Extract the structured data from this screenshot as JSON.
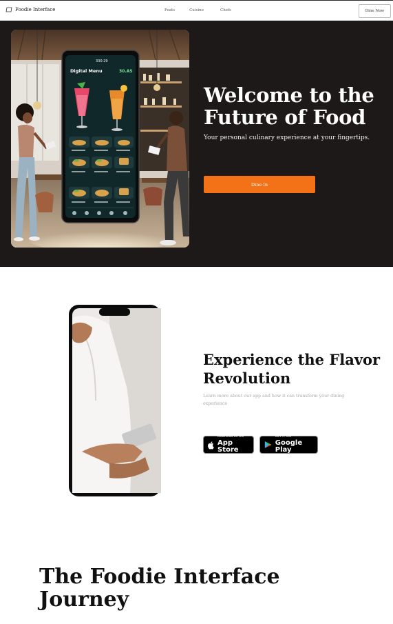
{
  "header": {
    "brand": "Foodie Interface",
    "nav": [
      "Feats",
      "Cuisine",
      "Chefs"
    ],
    "cta": "Dine Now"
  },
  "hero": {
    "title": "Welcome to the Future of Food",
    "subtitle": "Your personal culinary experience at your fingertips.",
    "button": "Dine In",
    "image": {
      "menu_title": "Digital Menu",
      "clock": "330:29",
      "price": "30.AS"
    }
  },
  "experience": {
    "title": "Experience the Flavor Revolution",
    "description": "Learn more about our app and how it can transform your dining experience",
    "app_store": {
      "small": "Download on the",
      "big": "App Store"
    },
    "google_play": {
      "small": "GET IT ON",
      "big": "Google Play"
    }
  },
  "journey": {
    "title": "The Foodie Interface Journey"
  },
  "colors": {
    "accent": "#f47217",
    "hero_bg": "#1d1918",
    "screen_bg": "#10282a"
  }
}
